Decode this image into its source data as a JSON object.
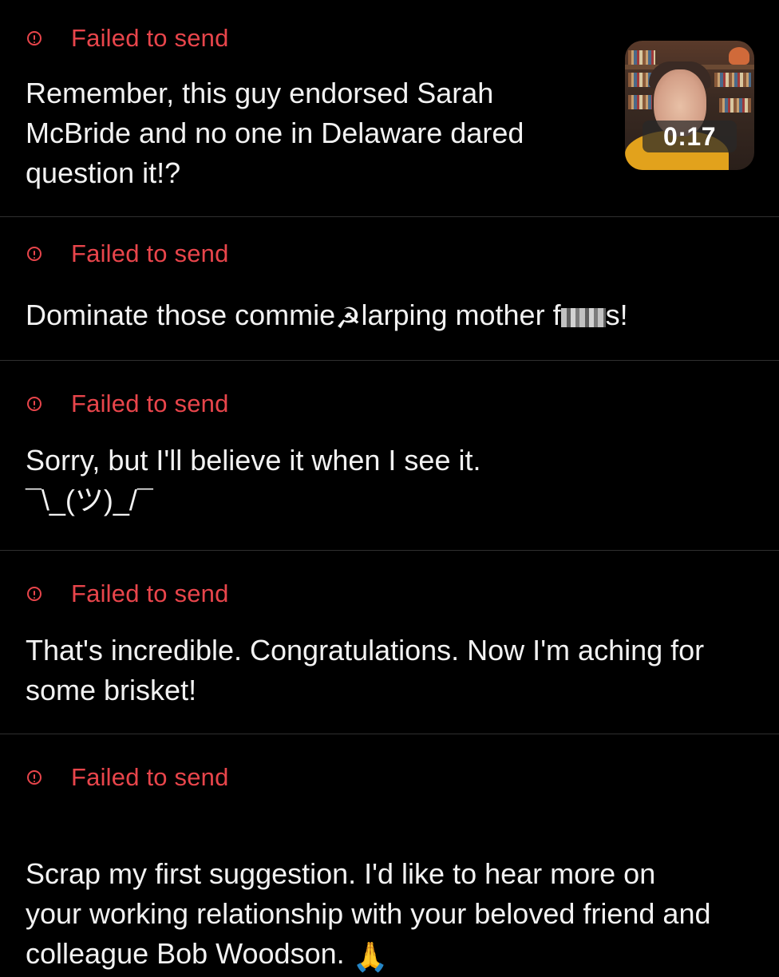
{
  "messages": [
    {
      "status": "Failed to send",
      "text": "Remember, this guy endorsed Sarah\nMcBride and no one in Delaware dared\nquestion it!?",
      "attachment": {
        "type": "video",
        "duration": "0:17"
      }
    },
    {
      "status": "Failed to send",
      "text_before": "Dominate those commie",
      "emoji": "☭",
      "text_middle": "larping mother f",
      "text_after": "s!"
    },
    {
      "status": "Failed to send",
      "text": "Sorry, but I'll believe it when I see it.\n¯\\_(ツ)_/¯"
    },
    {
      "status": "Failed to send",
      "text": "That's incredible. Congratulations. Now I'm aching for\nsome brisket!"
    },
    {
      "status": "Failed to send",
      "text": "Scrap my first suggestion. I'd like to hear more on\nyour working relationship with your beloved friend and\ncolleague Bob Woodson.",
      "emoji": "🙏"
    }
  ],
  "colors": {
    "background": "#000000",
    "error": "#e8454b",
    "text": "#f2f2f2",
    "divider": "#2f2f2f"
  },
  "icons": {
    "status": "alert-circle-icon",
    "attachment": "video-thumbnail"
  }
}
